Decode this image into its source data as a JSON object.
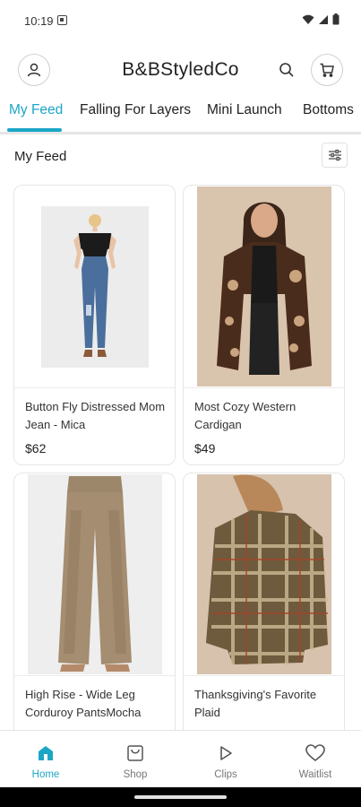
{
  "status_bar": {
    "time": "10:19"
  },
  "header": {
    "brand": "B&BStyledCo"
  },
  "tabs": [
    {
      "label": "My Feed",
      "active": true
    },
    {
      "label": "Falling For Layers",
      "active": false
    },
    {
      "label": "Mini Launch",
      "active": false
    },
    {
      "label": "Bottoms",
      "active": false
    }
  ],
  "feed": {
    "title": "My Feed"
  },
  "products": [
    {
      "name": "Button Fly Distressed Mom Jean - Mica",
      "price": "$62"
    },
    {
      "name": "Most Cozy Western Cardigan",
      "price": "$49"
    },
    {
      "name": "High Rise - Wide Leg Corduroy PantsMocha",
      "price": ""
    },
    {
      "name": "Thanksgiving's Favorite Plaid",
      "price": ""
    }
  ],
  "bottom_nav": [
    {
      "label": "Home",
      "icon": "home-icon",
      "active": true
    },
    {
      "label": "Shop",
      "icon": "shop-icon",
      "active": false
    },
    {
      "label": "Clips",
      "icon": "play-icon",
      "active": false
    },
    {
      "label": "Waitlist",
      "icon": "heart-icon",
      "active": false
    }
  ],
  "colors": {
    "accent": "#1ba6c6"
  }
}
